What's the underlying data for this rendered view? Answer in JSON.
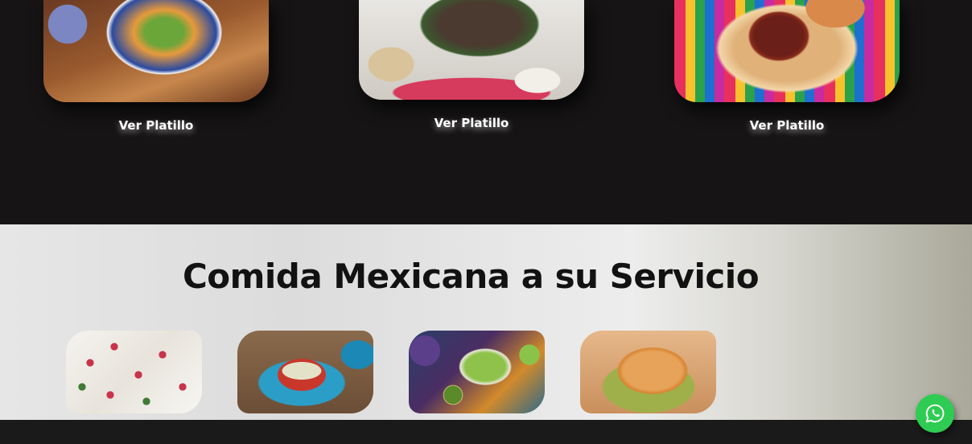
{
  "featured_dishes": [
    {
      "button_label": "Ver Platillo",
      "image": "pozole-bowl"
    },
    {
      "button_label": "Ver Platillo",
      "image": "barbacoa-plate"
    },
    {
      "button_label": "Ver Platillo",
      "image": "cochinita-pibil"
    }
  ],
  "services": {
    "title": "Comida Mexicana a su Servicio",
    "thumbnails": [
      {
        "image": "chiles-en-nogada"
      },
      {
        "image": "enchiladas-plate"
      },
      {
        "image": "enfrijoladas-platter"
      },
      {
        "image": "tamales-plate"
      }
    ]
  },
  "floating": {
    "whatsapp_icon": "whatsapp-icon",
    "whatsapp_color": "#2ecc52"
  },
  "colors": {
    "dark_bg": "#161415",
    "heading": "#121212",
    "button_text": "#ffffff"
  }
}
